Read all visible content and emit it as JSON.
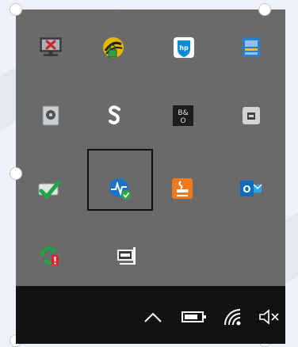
{
  "theme": {
    "flyout_bg": "#6a6a6a",
    "taskbar_bg": "#121212",
    "selection_border": "#111111"
  },
  "tray_icons": [
    {
      "name": "network-error-icon"
    },
    {
      "name": "security-lock-icon"
    },
    {
      "name": "hp-support-icon"
    },
    {
      "name": "display-settings-icon"
    },
    {
      "name": "hard-drive-icon"
    },
    {
      "name": "dollar-app-icon"
    },
    {
      "name": "bang-olufsen-icon",
      "text": "B&O"
    },
    {
      "name": "usb-device-icon"
    },
    {
      "name": "sync-ok-icon"
    },
    {
      "name": "hp-wolf-security-icon",
      "selected": true
    },
    {
      "name": "java-icon"
    },
    {
      "name": "outlook-icon",
      "text": "O"
    },
    {
      "name": "refresh-alert-icon"
    },
    {
      "name": "presentation-icon"
    }
  ],
  "taskbar": {
    "items": [
      {
        "name": "show-hidden-icons-chevron-icon",
        "glyph": "^"
      },
      {
        "name": "battery-icon"
      },
      {
        "name": "wifi-icon"
      },
      {
        "name": "volume-muted-icon"
      }
    ]
  }
}
